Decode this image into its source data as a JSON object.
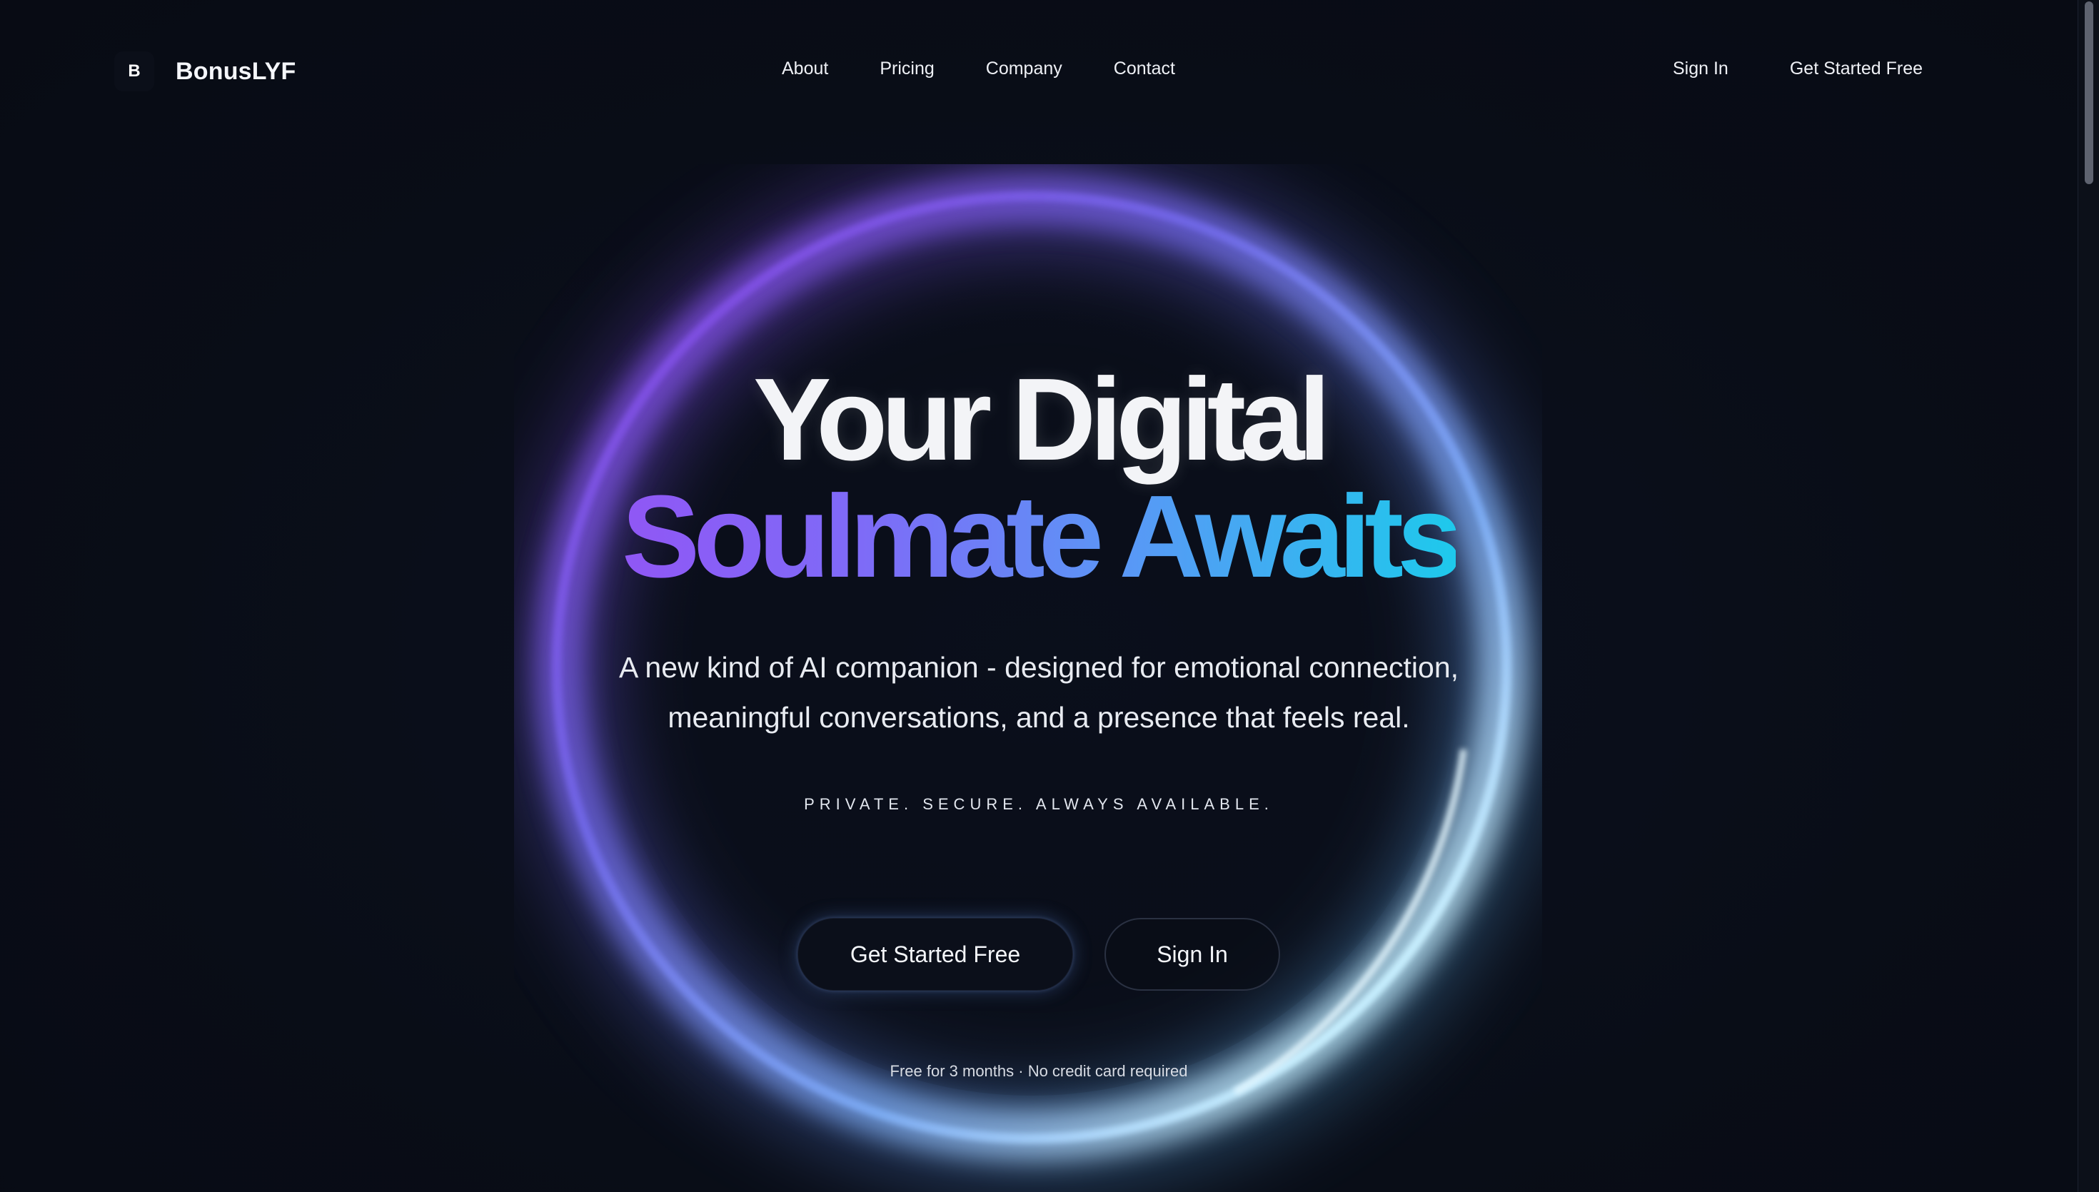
{
  "brand": {
    "mark": "B",
    "name": "BonusLYF"
  },
  "nav": {
    "links": [
      "About",
      "Pricing",
      "Company",
      "Contact"
    ],
    "sign_in": "Sign In",
    "get_started": "Get Started Free"
  },
  "hero": {
    "headline_line1": "Your Digital",
    "headline_line2": "Soulmate Awaits",
    "subtitle_line1": "A new kind of AI companion - designed for emotional connection,",
    "subtitle_line2": "meaningful conversations, and a presence that feels real.",
    "tagline": "PRIVATE. SECURE. ALWAYS AVAILABLE.",
    "primary_cta": "Get Started Free",
    "secondary_cta": "Sign In",
    "footnote": "Free for 3 months · No credit card required"
  },
  "colors": {
    "background": "#090d17",
    "gradient_start": "#9057f5",
    "gradient_mid": "#5a97f6",
    "gradient_end": "#1ec9ec",
    "ring_glow_highlight": "#d8f4ff"
  }
}
